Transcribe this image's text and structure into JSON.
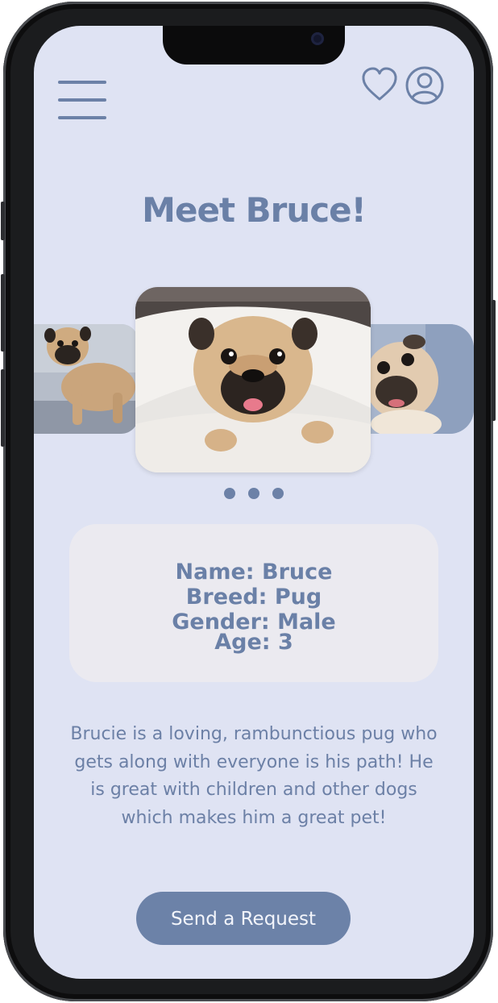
{
  "header": {
    "menu_icon": "hamburger-menu-icon",
    "favorites_icon": "heart-icon",
    "profile_icon": "user-profile-icon"
  },
  "page": {
    "title": "Meet Bruce!"
  },
  "carousel": {
    "photos": [
      "pug-standing-photo",
      "pug-under-blanket-photo",
      "pug-closeup-photo"
    ],
    "indicator_count": 3
  },
  "profile": {
    "name_line": "Name: Bruce",
    "breed_line": "Breed: Pug",
    "gender_line": "Gender: Male",
    "age_line": "Age: 3"
  },
  "description": "Brucie is a loving, rambunctious pug who gets along with everyone is his path! He is great with children and other dogs which makes him a great pet!",
  "actions": {
    "request_label": "Send a Request"
  },
  "colors": {
    "background": "#dfe3f3",
    "accent": "#6c81a7",
    "card": "#ebeaf0",
    "button_text": "#f3f5fb"
  }
}
